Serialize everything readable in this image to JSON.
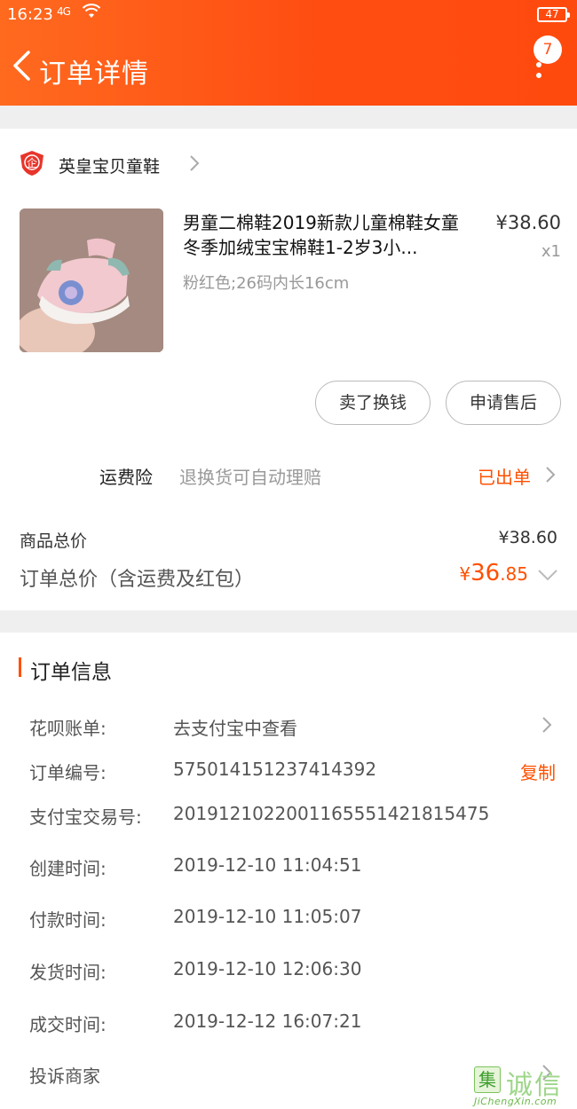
{
  "status_bar": {
    "time": "16:23",
    "network": "4G",
    "battery": "47"
  },
  "header": {
    "title": "订单详情",
    "notification_count": "7"
  },
  "shop": {
    "name": "英皇宝贝童鞋"
  },
  "product": {
    "title": "男童二棉鞋2019新款儿童棉鞋女童冬季加绒宝宝棉鞋1-2岁3小...",
    "price": "¥38.60",
    "quantity": "x1",
    "sku": "粉红色;26码内长16cm"
  },
  "actions": {
    "sell_label": "卖了换钱",
    "aftersale_label": "申请售后"
  },
  "insurance": {
    "label": "运费险",
    "description": "退换货可自动理赔",
    "status": "已出单"
  },
  "totals": {
    "goods_label": "商品总价",
    "goods_value": "¥38.60",
    "order_label": "订单总价（含运费及红包）",
    "order_currency": "¥",
    "order_integer": "36",
    "order_decimal": ".85"
  },
  "order_info": {
    "title": "订单信息",
    "rows": [
      {
        "label": "花呗账单:",
        "value": "去支付宝中查看"
      },
      {
        "label": "订单编号:",
        "value": "575014151237414392",
        "action": "复制"
      },
      {
        "label": "支付宝交易号:",
        "value": "2019121022001165551421815475"
      },
      {
        "label": "创建时间:",
        "value": "2019-12-10 11:04:51"
      },
      {
        "label": "付款时间:",
        "value": "2019-12-10 11:05:07"
      },
      {
        "label": "发货时间:",
        "value": "2019-12-10 12:06:30"
      },
      {
        "label": "成交时间:",
        "value": "2019-12-12 16:07:21"
      },
      {
        "label": "投诉商家",
        "value": ""
      }
    ]
  },
  "watermark": {
    "box_char": "集",
    "chars": "诚信",
    "url": "JiChengXin.com"
  },
  "colors": {
    "header_orange": "#ff4d12",
    "accent": "#ff5000",
    "background": "#efefef"
  },
  "icons": [
    "back-arrow-icon",
    "more-vertical-icon",
    "shop-logo-icon",
    "chevron-right-icon",
    "chevron-down-icon"
  ]
}
